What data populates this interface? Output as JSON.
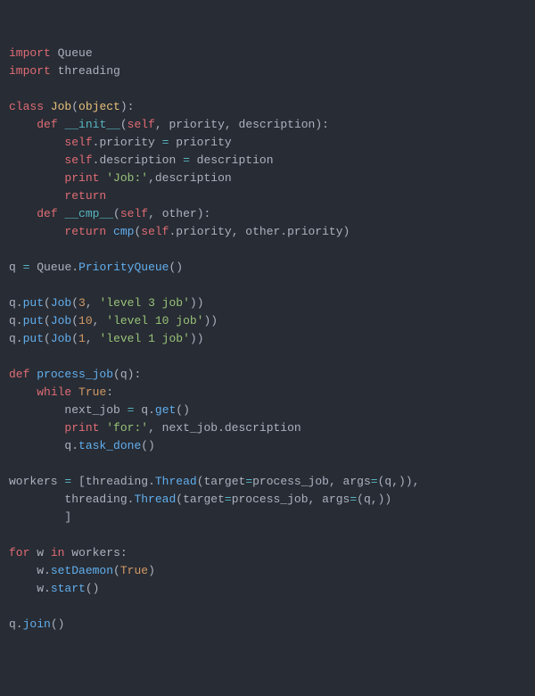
{
  "imports": [
    "Queue",
    "threading"
  ],
  "class_name": "Job",
  "class_base": "object",
  "init_params": [
    "self",
    "priority",
    "description"
  ],
  "init_body": {
    "assign1_lhs": "self.priority",
    "assign1_rhs": "priority",
    "assign2_lhs": "self.description",
    "assign2_rhs": "description",
    "print_label": "'Job:'",
    "print_var": "description",
    "return_kw": "return"
  },
  "cmp_params": [
    "self",
    "other"
  ],
  "cmp_body": {
    "return_kw": "return",
    "call": "cmp(self.priority, other.priority)"
  },
  "q_assign": {
    "var": "q",
    "call": "Queue.PriorityQueue()"
  },
  "puts": [
    {
      "priority": "3",
      "label": "'level 3 job'"
    },
    {
      "priority": "10",
      "label": "'level 10 job'"
    },
    {
      "priority": "1",
      "label": "'level 1 job'"
    }
  ],
  "process_fn": "process_job",
  "process_param": "q",
  "while_cond": "True",
  "next_job_var": "next_job",
  "q_get": "q.get()",
  "print_for": "'for:'",
  "print_for_var": "next_job.description",
  "task_done": "q.task_done()",
  "workers_var": "workers",
  "thread_call": "threading.Thread",
  "thread_target": "process_job",
  "thread_args": "(q,)",
  "for_var": "w",
  "for_iter": "workers",
  "setdaemon": "w.setDaemon",
  "setdaemon_arg": "True",
  "start": "w.start()",
  "join": "q.join()",
  "kw": {
    "import": "import",
    "class": "class",
    "def": "def",
    "return": "return",
    "print": "print",
    "while": "while",
    "for": "for",
    "in": "in",
    "init": "__init__",
    "cmp": "__cmp__"
  }
}
